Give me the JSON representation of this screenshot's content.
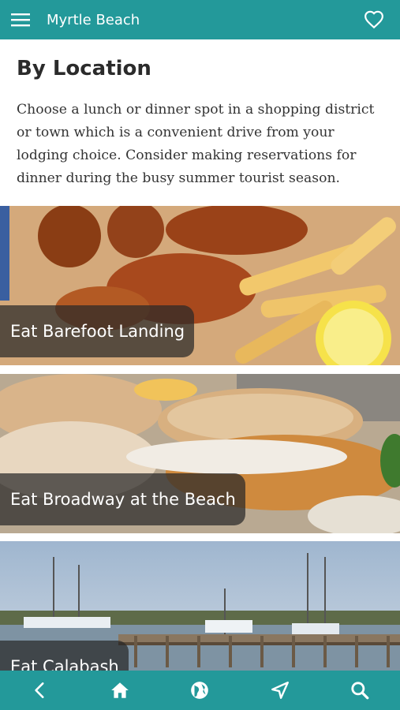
{
  "header": {
    "title": "Myrtle Beach",
    "menu_icon": "hamburger-menu-icon",
    "favorite_icon": "heart-icon"
  },
  "page": {
    "heading": "By Location",
    "intro": "Choose a lunch or dinner spot in a shopping district or town which is a convenient drive from your lodging choice. Consider making reservations for dinner during the busy summer tourist season."
  },
  "cards": [
    {
      "label": "Eat Barefoot Landing",
      "image": "fried seafood platter with fries and lemon"
    },
    {
      "label": "Eat Broadway at the Beach",
      "image": "fried fish po-boy sandwich"
    },
    {
      "label": "Eat Calabash",
      "image": "shrimp boats at a waterfront dock"
    }
  ],
  "bottom_nav": [
    {
      "icon": "back-arrow-icon"
    },
    {
      "icon": "home-icon"
    },
    {
      "icon": "globe-icon"
    },
    {
      "icon": "navigate-icon"
    },
    {
      "icon": "search-icon"
    }
  ],
  "colors": {
    "brand": "#23999a",
    "label_bg": "rgba(40,40,40,0.72)",
    "text": "#333333"
  }
}
